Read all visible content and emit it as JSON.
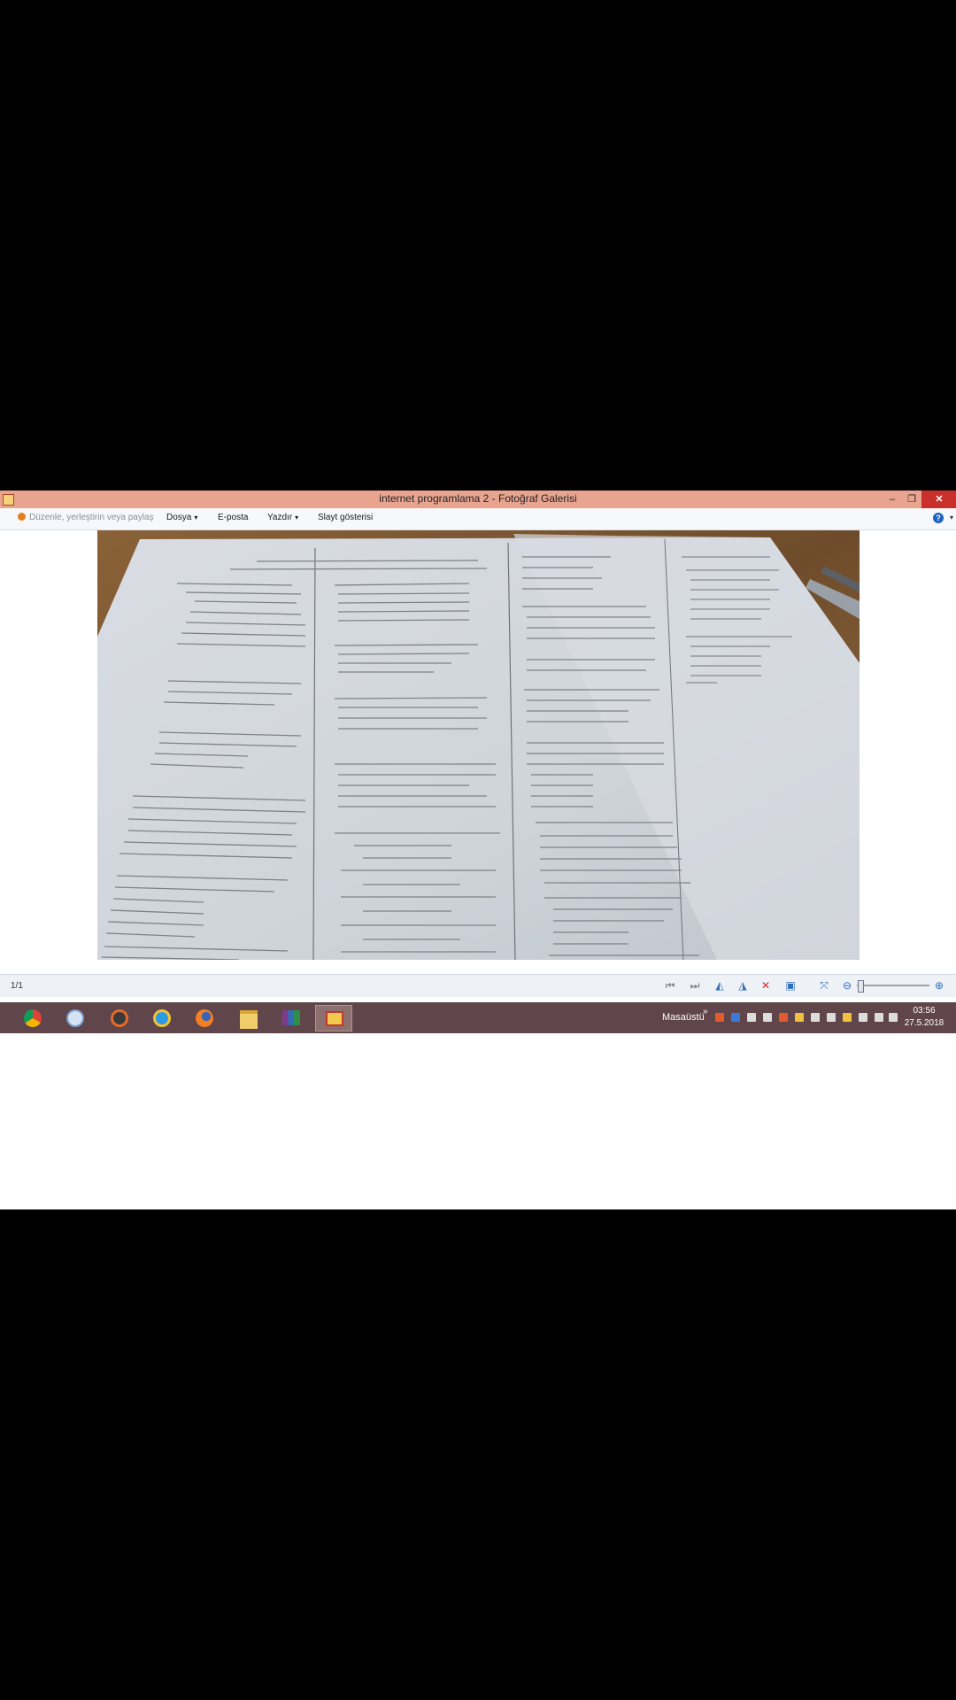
{
  "window": {
    "title": "internet programlama 2 - Fotoğraf Galerisi",
    "minimize_glyph": "–",
    "maximize_glyph": "❐",
    "close_glyph": "✕"
  },
  "toolbar": {
    "organize_label": "Düzenle, yerleştirin veya paylaş",
    "file_label": "Dosya",
    "email_label": "E-posta",
    "print_label": "Yazdır",
    "slideshow_label": "Slayt gösterisi",
    "help_glyph": "?"
  },
  "photo": {
    "description_icon": "photo-of-exam-paper"
  },
  "statusbar": {
    "page_count": "1/1"
  },
  "taskbar": {
    "apps": [
      "chrome",
      "paint",
      "media-player",
      "internet-explorer",
      "firefox",
      "file-explorer",
      "winrar",
      "photo-gallery"
    ],
    "desktop_label": "Masaüstü",
    "tray_chevron": "»",
    "time": "03:56",
    "date": "27.5.2018"
  },
  "colors": {
    "titlebar": "#e9a48f",
    "taskbar": "#60454a",
    "close_button": "#c9302c"
  }
}
